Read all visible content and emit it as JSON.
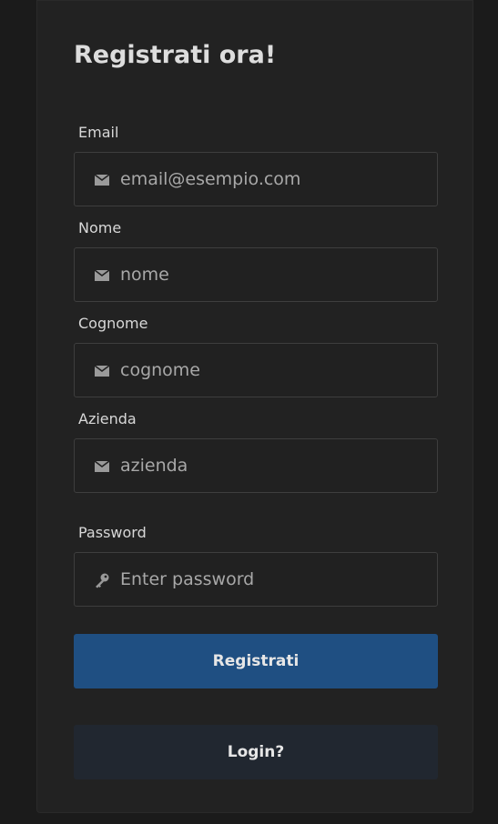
{
  "form": {
    "title": "Registrati ora!",
    "fields": [
      {
        "label": "Email",
        "placeholder": "email@esempio.com",
        "icon": "envelope-icon"
      },
      {
        "label": "Nome",
        "placeholder": "nome",
        "icon": "envelope-icon"
      },
      {
        "label": "Cognome",
        "placeholder": "cognome",
        "icon": "envelope-icon"
      },
      {
        "label": "Azienda",
        "placeholder": "azienda",
        "icon": "envelope-icon"
      },
      {
        "label": "Password",
        "placeholder": "Enter password",
        "icon": "key-icon"
      }
    ],
    "submit_label": "Registrati",
    "login_label": "Login?"
  },
  "colors": {
    "page_background": "#1b1b1b",
    "card_background": "#222222",
    "primary_button": "#1f4f82",
    "secondary_button": "#212730"
  }
}
